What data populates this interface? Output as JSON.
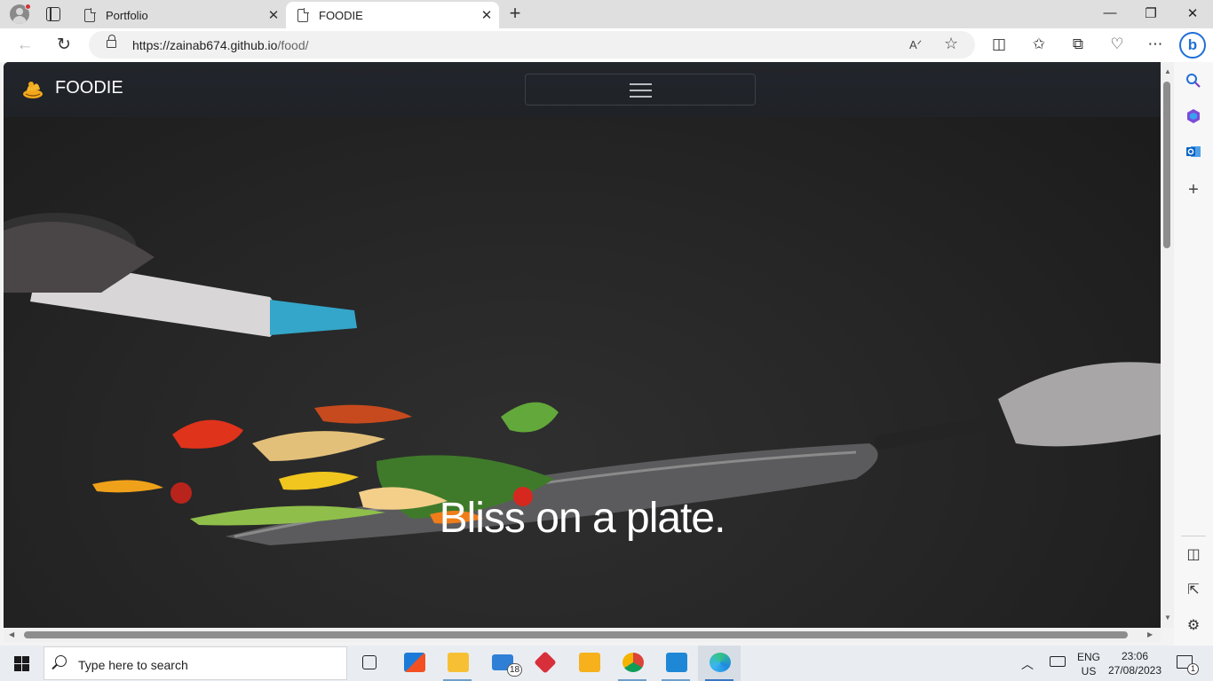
{
  "browser": {
    "tabs": [
      {
        "title": "Portfolio",
        "active": false
      },
      {
        "title": "FOODIE",
        "active": true
      }
    ],
    "url_host": "https://zainab674.github.io",
    "url_path": "/food/",
    "read_aloud_label": "A",
    "icons": [
      "profile-icon",
      "tab-actions-icon",
      "page-icon",
      "close-icon",
      "new-tab-icon",
      "minimize-icon",
      "restore-icon",
      "window-close-icon",
      "back-icon",
      "refresh-icon",
      "lock-icon",
      "read-aloud-icon",
      "favorite-star-icon",
      "split-screen-icon",
      "favorites-icon",
      "collections-icon",
      "browser-essentials-icon",
      "more-icon",
      "bing-copilot-icon"
    ]
  },
  "sidebar": {
    "icons": [
      "search-icon",
      "office-icon",
      "outlook-icon",
      "add-icon",
      "hide-sidebar-icon",
      "external-link-icon",
      "settings-icon"
    ]
  },
  "page": {
    "brand": "FOODIE",
    "tagline": "Bliss on a plate.",
    "accent": "#ffffff",
    "logo_color": "#f2a71b"
  },
  "taskbar": {
    "search_placeholder": "Type here to search",
    "apps": [
      "task-view-icon",
      "microsoft-store-icon",
      "file-explorer-icon",
      "mail-icon",
      "git-icon",
      "bitcoin-icon",
      "chrome-icon",
      "vscode-icon",
      "edge-icon"
    ],
    "mail_badge": "18",
    "language_line1": "ENG",
    "language_line2": "US",
    "time": "23:06",
    "date": "27/08/2023",
    "notification_count": "1"
  }
}
